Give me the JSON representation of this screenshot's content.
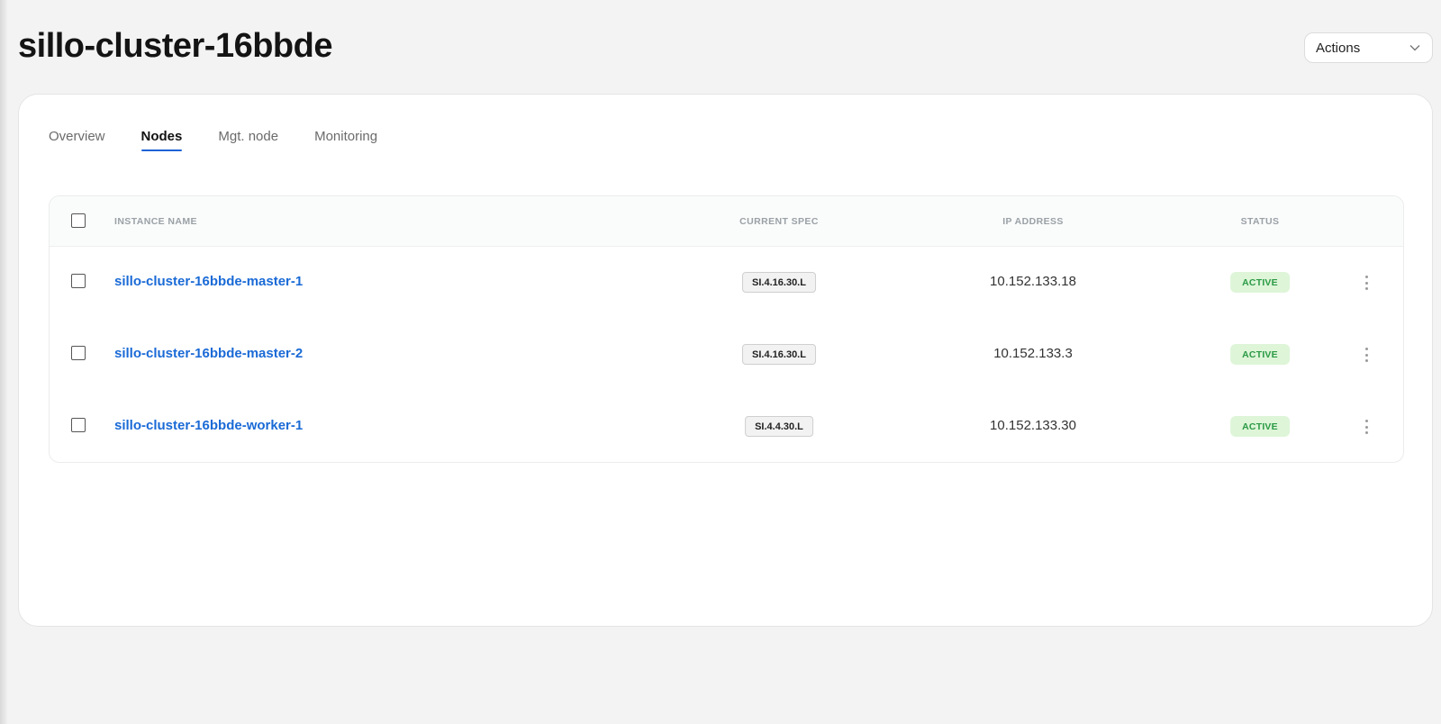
{
  "header": {
    "title": "sillo-cluster-16bbde",
    "actions_label": "Actions"
  },
  "tabs": [
    {
      "label": "Overview",
      "active": false
    },
    {
      "label": "Nodes",
      "active": true
    },
    {
      "label": "Mgt. node",
      "active": false
    },
    {
      "label": "Monitoring",
      "active": false
    }
  ],
  "table": {
    "columns": {
      "instance_name": "INSTANCE NAME",
      "current_spec": "CURRENT SPEC",
      "ip_address": "IP ADDRESS",
      "status": "STATUS"
    },
    "rows": [
      {
        "name": "sillo-cluster-16bbde-master-1",
        "spec": "SI.4.16.30.L",
        "ip": "10.152.133.18",
        "status": "ACTIVE"
      },
      {
        "name": "sillo-cluster-16bbde-master-2",
        "spec": "SI.4.16.30.L",
        "ip": "10.152.133.3",
        "status": "ACTIVE"
      },
      {
        "name": "sillo-cluster-16bbde-worker-1",
        "spec": "SI.4.4.30.L",
        "ip": "10.152.133.30",
        "status": "ACTIVE"
      }
    ]
  },
  "colors": {
    "link": "#1a6ad6",
    "tab_underline": "#1e63d6",
    "status_bg": "#def5d8",
    "status_text": "#2b9a45"
  },
  "icons": {
    "actions_chevron": "chevron-down-icon",
    "row_menu": "kebab-menu-icon"
  }
}
